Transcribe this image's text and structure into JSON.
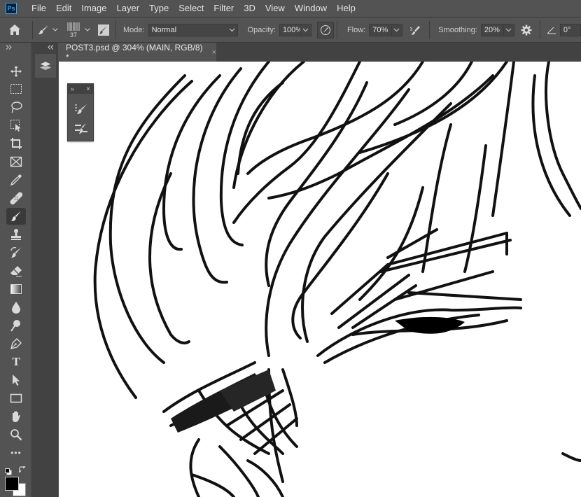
{
  "app": {
    "logo_text": "Ps"
  },
  "menu": [
    "File",
    "Edit",
    "Image",
    "Layer",
    "Type",
    "Select",
    "Filter",
    "3D",
    "View",
    "Window",
    "Help"
  ],
  "options": {
    "brush_size": "37",
    "mode_label": "Mode:",
    "mode_value": "Normal",
    "opacity_label": "Opacity:",
    "opacity_value": "100%",
    "flow_label": "Flow:",
    "flow_value": "70%",
    "smoothing_label": "Smoothing:",
    "smoothing_value": "20%",
    "angle_value": "0°"
  },
  "document": {
    "tab_title": "POST3.psd @ 304% (MAIN, RGB/8) *",
    "close_glyph": "×"
  },
  "colors": {
    "foreground": "#000000",
    "background": "#ffffff",
    "ui_panel": "#535353",
    "ui_dark": "#424242",
    "accent": "#31a8ff"
  },
  "tools": [
    "move-tool",
    "marquee-tool",
    "lasso-tool",
    "object-selection-tool",
    "crop-tool",
    "frame-tool",
    "eyedropper-tool",
    "healing-brush-tool",
    "brush-tool",
    "clone-stamp-tool",
    "history-brush-tool",
    "eraser-tool",
    "gradient-tool",
    "blur-tool",
    "dodge-tool",
    "pen-tool",
    "type-tool",
    "path-selection-tool",
    "rectangle-tool",
    "hand-tool",
    "zoom-tool",
    "edit-toolbar"
  ],
  "type_tool_glyph": "T",
  "edit_toolbar_glyph": "•••",
  "mini_panel_collapse": "»",
  "mini_panel_close": "×"
}
